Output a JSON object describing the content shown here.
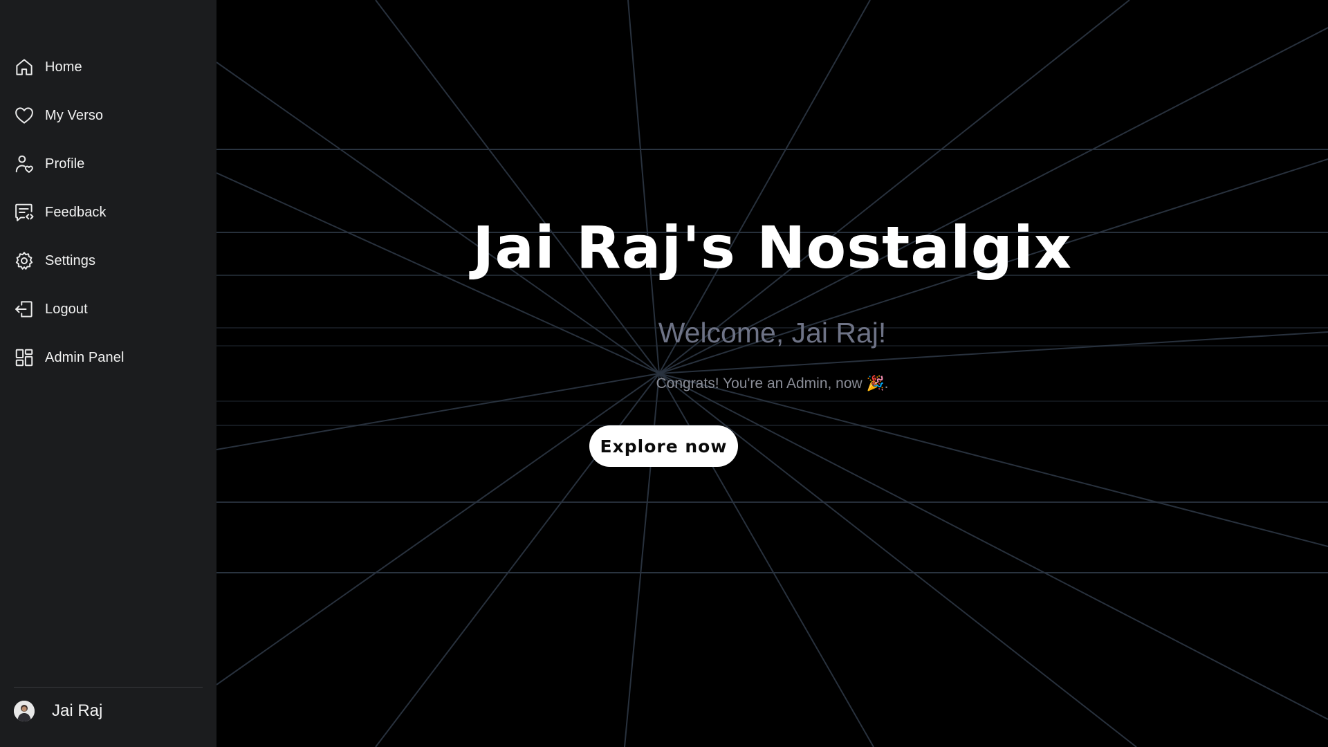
{
  "sidebar": {
    "items": [
      {
        "label": "Home",
        "icon": "home-icon"
      },
      {
        "label": "My Verso",
        "icon": "heart-icon"
      },
      {
        "label": "Profile",
        "icon": "user-heart-icon"
      },
      {
        "label": "Feedback",
        "icon": "feedback-icon"
      },
      {
        "label": "Settings",
        "icon": "gear-icon"
      },
      {
        "label": "Logout",
        "icon": "logout-icon"
      },
      {
        "label": "Admin Panel",
        "icon": "grid-icon"
      }
    ],
    "user": {
      "name": "Jai Raj",
      "avatar_icon": "avatar"
    }
  },
  "hero": {
    "title": "Jai Raj's Nostalgix",
    "welcome": "Welcome, Jai Raj!",
    "congrats": "Congrats! You're an Admin, now 🎉.",
    "cta_label": "Explore now"
  },
  "colors": {
    "sidebar_bg": "#1b1c1e",
    "main_bg": "#000000",
    "title": "#ffffff",
    "welcome": "#6e7386",
    "congrats": "#8a8d97",
    "grid_lines": "#2a3440",
    "button_bg": "#ffffff",
    "button_text": "#0a0a0a"
  }
}
